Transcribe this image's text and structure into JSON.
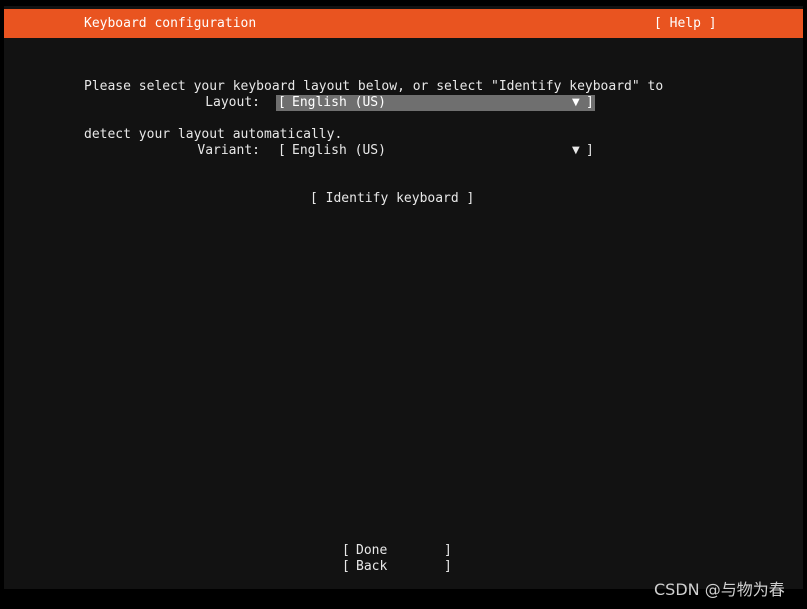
{
  "header": {
    "title": "Keyboard configuration",
    "help_label": "[ Help ]"
  },
  "intro": {
    "line1": "Please select your keyboard layout below, or select \"Identify keyboard\" to",
    "line2": "detect your layout automatically."
  },
  "layout": {
    "label": "Layout:",
    "open_bracket": "[",
    "value": "English (US)",
    "arrow": "▼",
    "close_bracket": "]"
  },
  "variant": {
    "label": "Variant:",
    "open_bracket": "[",
    "value": "English (US)",
    "arrow": "▼",
    "close_bracket": "]"
  },
  "identify_button": "[ Identify keyboard ]",
  "footer": {
    "done_label": "Done",
    "back_label": "Back",
    "open_bracket": "[",
    "close_bracket": "]"
  },
  "watermark": "CSDN @与物为春",
  "colors": {
    "header_bg": "#e95420",
    "screen_bg": "#121212",
    "focused_select_bg": "#6f6f6f",
    "text": "#e8e8e8"
  }
}
